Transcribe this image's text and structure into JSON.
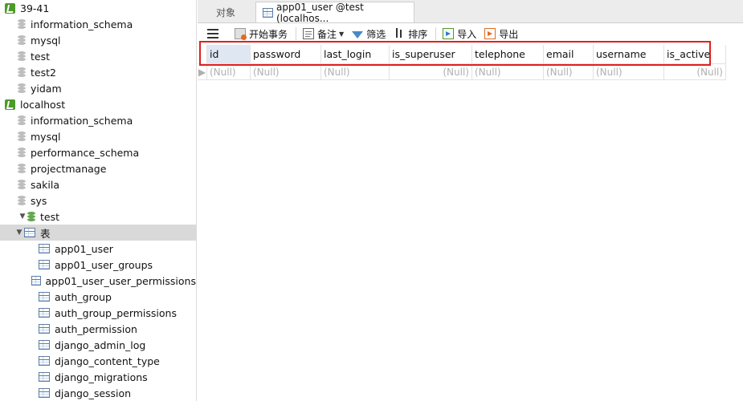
{
  "sidebar": {
    "items": [
      {
        "label": "39-41",
        "kind": "connection",
        "level": 0
      },
      {
        "label": "information_schema",
        "kind": "database",
        "level": 1
      },
      {
        "label": "mysql",
        "kind": "database",
        "level": 1
      },
      {
        "label": "test",
        "kind": "database",
        "level": 1
      },
      {
        "label": "test2",
        "kind": "database",
        "level": 1
      },
      {
        "label": "yidam",
        "kind": "database",
        "level": 1
      },
      {
        "label": "localhost",
        "kind": "connection",
        "level": 0
      },
      {
        "label": "information_schema",
        "kind": "database",
        "level": 1
      },
      {
        "label": "mysql",
        "kind": "database",
        "level": 1
      },
      {
        "label": "performance_schema",
        "kind": "database",
        "level": 1
      },
      {
        "label": "projectmanage",
        "kind": "database",
        "level": 1
      },
      {
        "label": "sakila",
        "kind": "database",
        "level": 1
      },
      {
        "label": "sys",
        "kind": "database",
        "level": 1
      },
      {
        "label": "test",
        "kind": "database-open",
        "level": 1
      },
      {
        "label": "表",
        "kind": "folder-tables",
        "level": 2
      },
      {
        "label": "app01_user",
        "kind": "table",
        "level": 3
      },
      {
        "label": "app01_user_groups",
        "kind": "table",
        "level": 3
      },
      {
        "label": "app01_user_user_permissions",
        "kind": "table",
        "level": 3
      },
      {
        "label": "auth_group",
        "kind": "table",
        "level": 3
      },
      {
        "label": "auth_group_permissions",
        "kind": "table",
        "level": 3
      },
      {
        "label": "auth_permission",
        "kind": "table",
        "level": 3
      },
      {
        "label": "django_admin_log",
        "kind": "table",
        "level": 3
      },
      {
        "label": "django_content_type",
        "kind": "table",
        "level": 3
      },
      {
        "label": "django_migrations",
        "kind": "table",
        "level": 3
      },
      {
        "label": "django_session",
        "kind": "table",
        "level": 3
      }
    ]
  },
  "tabs": {
    "objects_label": "对象",
    "active_label": "app01_user @test (localhos..."
  },
  "toolbar": {
    "begin_transaction": "开始事务",
    "memo": "备注",
    "filter": "筛选",
    "sort": "排序",
    "import": "导入",
    "export": "导出"
  },
  "grid": {
    "columns": [
      "id",
      "password",
      "last_login",
      "is_superuser",
      "telephone",
      "email",
      "username",
      "is_active"
    ],
    "rows": [
      [
        "(Null)",
        "(Null)",
        "(Null)",
        "(Null)",
        "(Null)",
        "(Null)",
        "(Null)",
        "(Null)"
      ]
    ]
  },
  "colors": {
    "highlight_border": "#e02020",
    "connection_icon": "#4c9a2a",
    "selected_row": "#d9d9d9"
  }
}
